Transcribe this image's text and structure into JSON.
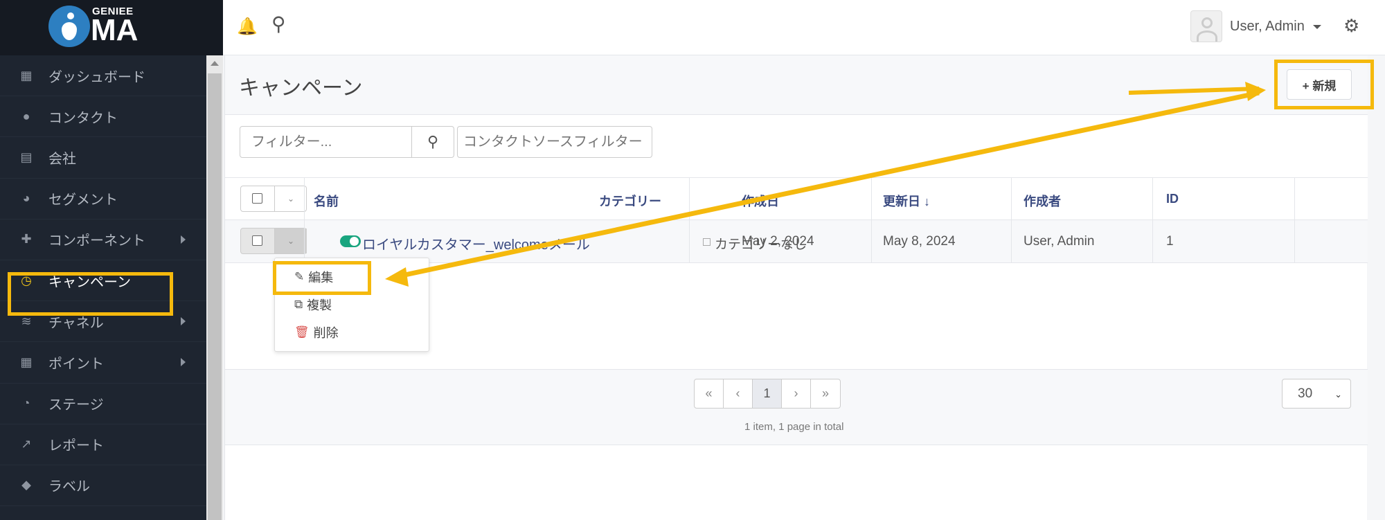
{
  "logo": {
    "small": "GENIEE",
    "big": "MA"
  },
  "sidebar": {
    "items": [
      {
        "label": "ダッシュボード",
        "icon": "dashboard-icon",
        "glyph": "▦"
      },
      {
        "label": "コンタクト",
        "icon": "user-icon",
        "glyph": "●"
      },
      {
        "label": "会社",
        "icon": "building-icon",
        "glyph": "▤"
      },
      {
        "label": "セグメント",
        "icon": "pie-chart-icon",
        "glyph": "◕"
      },
      {
        "label": "コンポーネント",
        "icon": "puzzle-icon",
        "glyph": "✚"
      },
      {
        "label": "キャンペーン",
        "icon": "clock-icon",
        "glyph": "◷"
      },
      {
        "label": "チャネル",
        "icon": "rss-icon",
        "glyph": "≋"
      },
      {
        "label": "ポイント",
        "icon": "calculator-icon",
        "glyph": "▦"
      },
      {
        "label": "ステージ",
        "icon": "gauge-icon",
        "glyph": "◔"
      },
      {
        "label": "レポート",
        "icon": "line-chart-icon",
        "glyph": "↗"
      },
      {
        "label": "ラベル",
        "icon": "tag-icon",
        "glyph": "◆"
      }
    ]
  },
  "topbar": {
    "bell": "🔔",
    "search": "⚲",
    "user_name": "User, Admin",
    "gear": "⚙"
  },
  "page": {
    "title": "キャンペーン",
    "new_button": "+ 新規"
  },
  "filters": {
    "filter_placeholder": "フィルター...",
    "source_placeholder": "コンタクトソースフィルター",
    "search_glyph": "⚲"
  },
  "table": {
    "headers": {
      "name": "名前",
      "category": "カテゴリー",
      "created": "作成日",
      "updated": "更新日 ↓",
      "author": "作成者",
      "id": "ID"
    },
    "row": {
      "name": "ロイヤルカスタマー_welcomeメール",
      "category": "カテゴリーなし",
      "created": "May 2, 2024",
      "updated": "May 8, 2024",
      "author": "User, Admin",
      "id": "1"
    },
    "caret": "⌄"
  },
  "row_menu": {
    "edit": "編集",
    "duplicate": "複製",
    "delete": "削除",
    "edit_glyph": "✎",
    "duplicate_glyph": "⧉",
    "delete_glyph": "🗑"
  },
  "pagination": {
    "first": "«",
    "prev": "‹",
    "current": "1",
    "next": "›",
    "last": "»",
    "info": "1 item, 1 page in total",
    "per_page": "30",
    "per_page_caret": "⌄"
  },
  "colors": {
    "sidebar_bg": "#1e2530",
    "highlight": "#f5b90d",
    "link": "#3a4a80",
    "toggle_on": "#19a57f",
    "danger": "#d9534f"
  }
}
